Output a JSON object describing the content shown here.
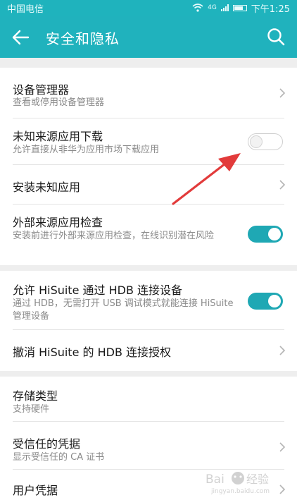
{
  "status_bar": {
    "carrier": "中国电信",
    "network": "4G",
    "time": "下午1:25"
  },
  "toolbar": {
    "title": "安全和隐私"
  },
  "sections": [
    {
      "rows": [
        {
          "title": "设备管理器",
          "subtitle": "查看或停用设备管理器",
          "control": "chevron"
        },
        {
          "title": "未知来源应用下载",
          "subtitle": "允许直接从非华为应用市场下载应用",
          "control": "toggle",
          "on": false
        },
        {
          "title": "安装未知应用",
          "subtitle": "",
          "control": "chevron"
        },
        {
          "title": "外部来源应用检查",
          "subtitle": "安装前进行外部来源应用检查，在线识别潜在风险",
          "control": "toggle",
          "on": true
        }
      ]
    },
    {
      "rows": [
        {
          "title": "允许 HiSuite 通过 HDB 连接设备",
          "subtitle": "通过 HDB，无需打开 USB 调试模式就能连接 HiSuite 管理设备",
          "control": "toggle",
          "on": true
        },
        {
          "title": "撤消 HiSuite 的 HDB 连接授权",
          "subtitle": "",
          "control": "chevron"
        }
      ]
    },
    {
      "rows": [
        {
          "title": "存储类型",
          "subtitle": "支持硬件",
          "control": "none"
        },
        {
          "title": "受信任的凭据",
          "subtitle": "显示受信任的 CA 证书",
          "control": "chevron"
        },
        {
          "title": "用户凭据",
          "subtitle": "",
          "control": "chevron"
        }
      ]
    }
  ],
  "colors": {
    "accent": "#20b2bd",
    "toggle_on": "#1fa8b4",
    "annotation_arrow": "#e23b3b"
  },
  "watermark": {
    "text": "Baidu经验",
    "sub": "jingyan.baidu.com"
  }
}
